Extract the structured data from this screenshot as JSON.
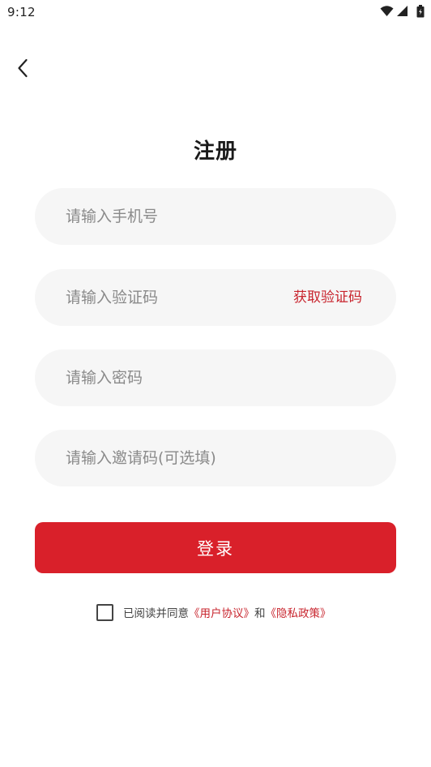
{
  "status_bar": {
    "time": "9:12",
    "icons": [
      "wifi-icon",
      "signal-icon",
      "battery-icon"
    ]
  },
  "header": {
    "back_icon": "chevron-left-icon",
    "title": "注册"
  },
  "form": {
    "phone_placeholder": "请输入手机号",
    "code_placeholder": "请输入验证码",
    "get_code_label": "获取验证码",
    "password_placeholder": "请输入密码",
    "invite_placeholder": "请输入邀请码(可选填)",
    "submit_label": "登录"
  },
  "agreement": {
    "checked": false,
    "prefix": "已阅读并同意",
    "user_agreement": "《用户协议》",
    "conjunction": "和",
    "privacy_policy": "《隐私政策》"
  },
  "colors": {
    "accent": "#d9202a",
    "link": "#c8242d",
    "field_bg": "#f6f6f6",
    "placeholder": "#8a8a8a"
  }
}
